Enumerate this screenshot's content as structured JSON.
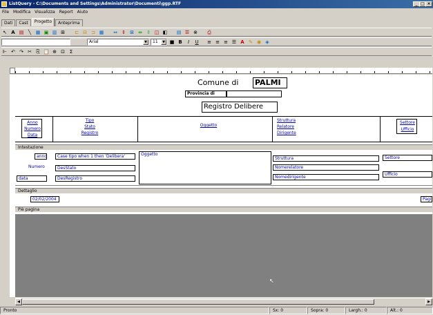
{
  "window": {
    "title": "ListQuery - C:\\Documents and Settings\\Administrator\\Documenti\\ggp.RTF"
  },
  "menu": [
    "File",
    "Modifica",
    "Visualizza",
    "Report",
    "Aiuto"
  ],
  "tabs": [
    "Dati",
    "Cast",
    "Progetto",
    "Anteprima"
  ],
  "toolbar": {
    "font": "Arial",
    "size": "11",
    "bold": "B",
    "italic": "I",
    "underline": "U"
  },
  "report": {
    "title_prefix": "Comune di",
    "title_name": "PALMI",
    "provincia_label": "Provincia di",
    "provincia_value": "",
    "subtitle": "Registro Delibere",
    "headers": {
      "col1": [
        "Anno",
        "Numero",
        "Data"
      ],
      "col2": [
        "Tipo",
        "Stato",
        "Registro"
      ],
      "col3": [
        "Oggetto"
      ],
      "col4": [
        "Struttura",
        "Relatore",
        "Dirigente"
      ],
      "col5": [
        "Settore",
        "Ufficio"
      ]
    },
    "bands": {
      "intestazione": "Intestazione",
      "dettaglio": "Dettaglio",
      "pie": "Piè pagina"
    },
    "detail_fields": {
      "anno": "anno",
      "numero": "Numero",
      "data": "data",
      "tipo": "Case tipo when 1 then 'Delibera'",
      "stato": "DesStato",
      "registro": "DesRegistro",
      "oggetto": "Oggetto",
      "struttura": "Struttura",
      "relatore": "Nomerelatore",
      "dirigente": "Nomedirigente",
      "settore": "Settore",
      "ufficio": "Ufficio"
    },
    "footer_date": "02/02/2004",
    "footer_page": "Pagi"
  },
  "status": {
    "left": "Pronto",
    "p1": "Sx: 0",
    "p2": "Sopra: 0",
    "p3": "Largh.: 0",
    "p4": "Alt.: 0"
  }
}
